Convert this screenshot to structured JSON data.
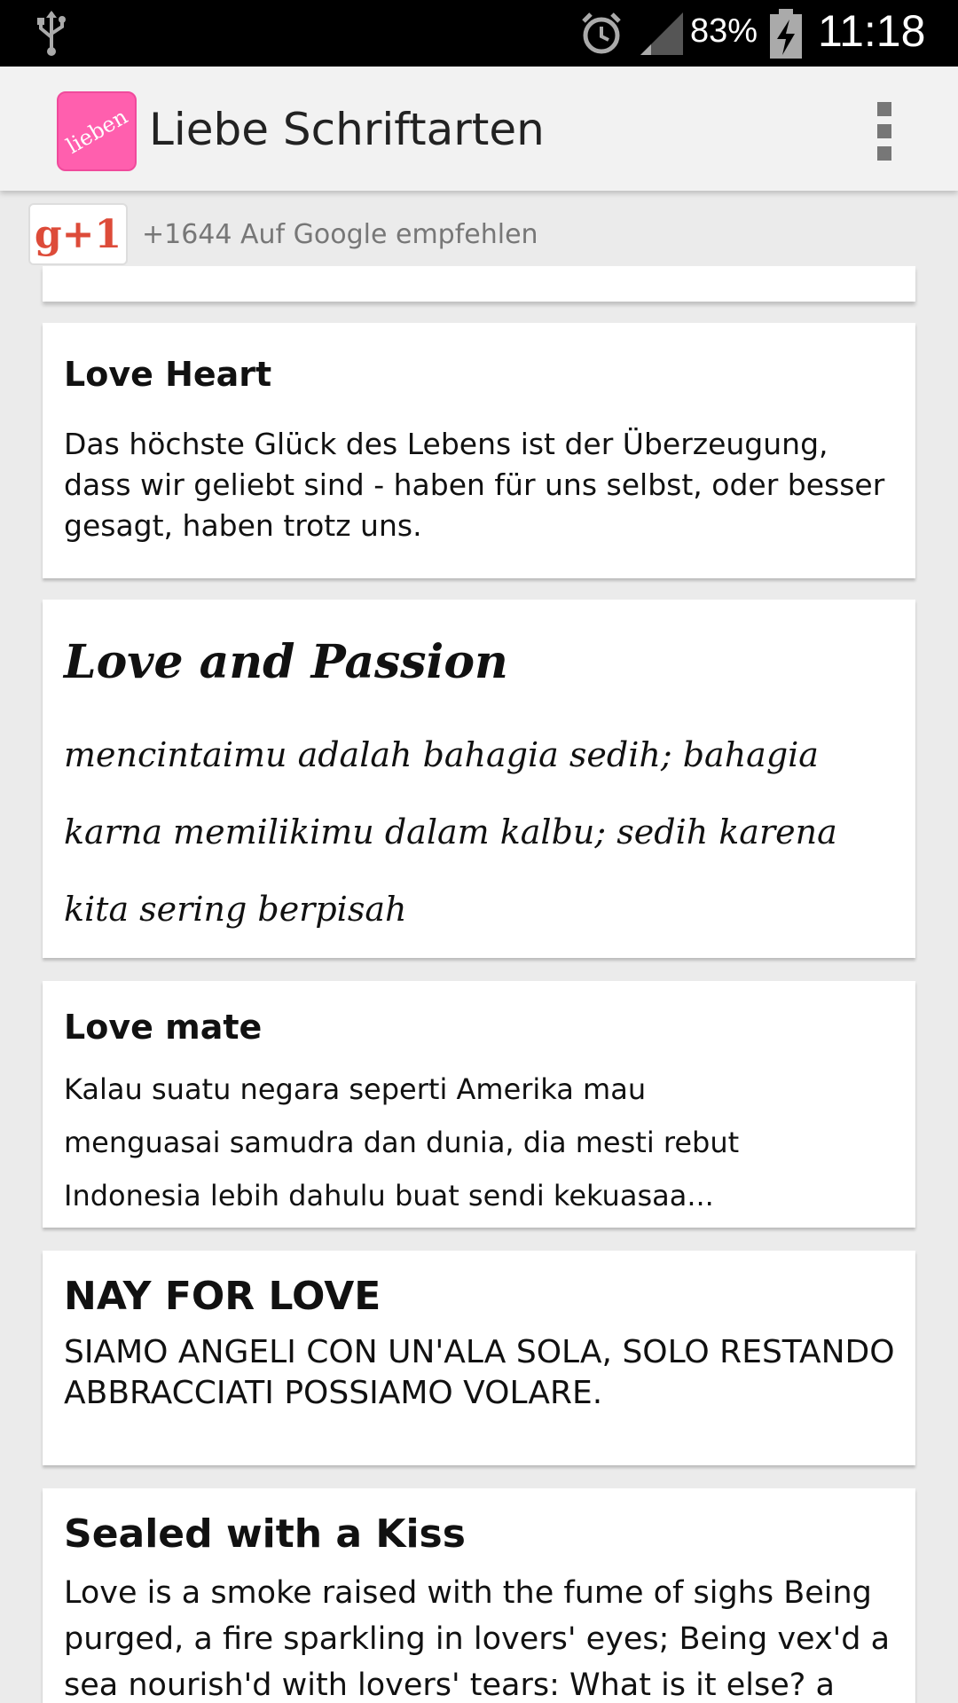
{
  "status_bar": {
    "usb_icon": "usb-icon",
    "alarm_icon": "alarm-clock-icon",
    "signal_icon": "signal-icon",
    "battery_percent": "83%",
    "battery_icon": "battery-charging-icon",
    "time": "11:18"
  },
  "action_bar": {
    "app_icon_text": "lieben",
    "title": "Liebe Schriftarten",
    "menu_icon": "overflow-menu-icon",
    "accent_color": "#ff5fae"
  },
  "gplus": {
    "button_label": "g+1",
    "count_text": "+1644 Auf Google empfehlen",
    "color": "#dd4b39"
  },
  "fonts": [
    {
      "name": "Love Heart",
      "sample": "Das höchste Glück des Lebens ist der Überzeugung, dass wir geliebt sind - haben für uns selbst, oder besser gesagt, haben trotz uns."
    },
    {
      "name": "Love and Passion",
      "sample": "mencintaimu adalah bahagia sedih; bahagia karna memilikimu dalam kalbu; sedih karena kita sering berpisah"
    },
    {
      "name": "Love mate",
      "sample_lines": [
        "Kalau suatu negara seperti Amerika mau",
        "menguasai samudra dan dunia, dia mesti rebut",
        "Indonesia lebih dahulu buat sendi kekuasaa..."
      ]
    },
    {
      "name": "NAY FOR LOVE",
      "sample": "SIAMO ANGELI CON UN'ALA SOLA, SOLO RESTANDO ABBRACCIATI POSSIAMO VOLARE."
    },
    {
      "name": "Sealed with a Kiss",
      "sample": "Love is a smoke raised with the fume of sighs Being purged, a fire sparkling in lovers' eyes; Being vex'd a sea nourish'd with lovers' tears: What is it else? a"
    }
  ]
}
